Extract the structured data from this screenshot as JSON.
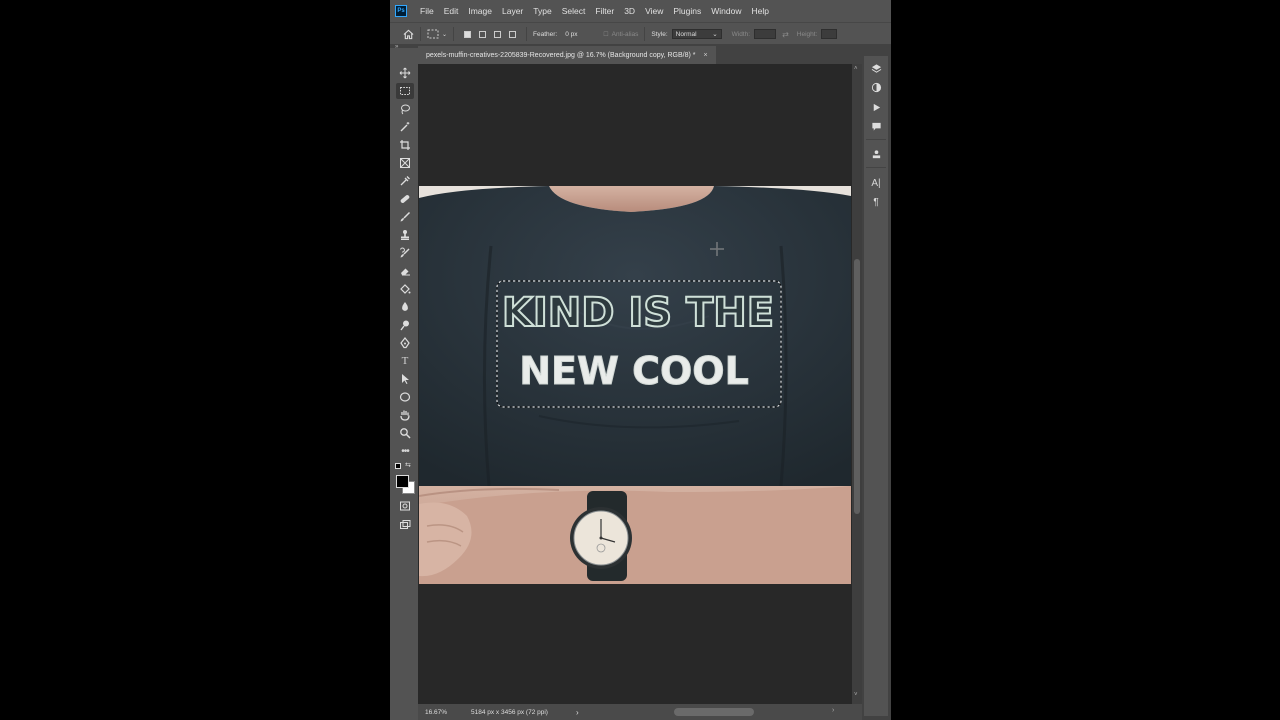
{
  "app": {
    "logo": "Ps"
  },
  "menu": [
    "File",
    "Edit",
    "Image",
    "Layer",
    "Type",
    "Select",
    "Filter",
    "3D",
    "View",
    "Plugins",
    "Window",
    "Help"
  ],
  "options": {
    "feather_label": "Feather:",
    "feather_value": "0 px",
    "antialias_label": "Anti-alias",
    "style_label": "Style:",
    "style_value": "Normal",
    "width_label": "Width:",
    "height_label": "Height:"
  },
  "document": {
    "tab_title": "pexels-muffin-creatives-2205839-Recovered.jpg @ 16.7% (Background copy, RGB/8) *",
    "close": "×"
  },
  "canvas": {
    "shirt_text_line1": "KIND IS THE",
    "shirt_text_line2": "NEW COOL"
  },
  "status": {
    "zoom": "16.67%",
    "doc_info": "5184 px x 3456 px (72 ppi)",
    "arrow": "›"
  },
  "colors": {
    "workspace": "#535353",
    "canvas_bg": "#282828",
    "shirt": "#2a3438",
    "skin": "#c9a596",
    "accent": "#31a8ff"
  },
  "toolbar_icons": [
    "move-icon",
    "rectangular-marquee-icon",
    "lasso-icon",
    "magic-wand-icon",
    "crop-icon",
    "frame-icon",
    "eyedropper-icon",
    "healing-brush-icon",
    "brush-icon",
    "clone-stamp-icon",
    "history-brush-icon",
    "eraser-icon",
    "paint-bucket-icon",
    "blur-icon",
    "dodge-icon",
    "pen-icon",
    "type-icon",
    "path-selection-icon",
    "ellipse-icon",
    "hand-icon",
    "zoom-icon",
    "more-tools-icon"
  ],
  "right_icons": [
    "layers-icon",
    "adjustments-icon",
    "play-actions-icon",
    "comments-icon",
    "libraries-icon",
    "character-icon",
    "paragraph-icon"
  ]
}
